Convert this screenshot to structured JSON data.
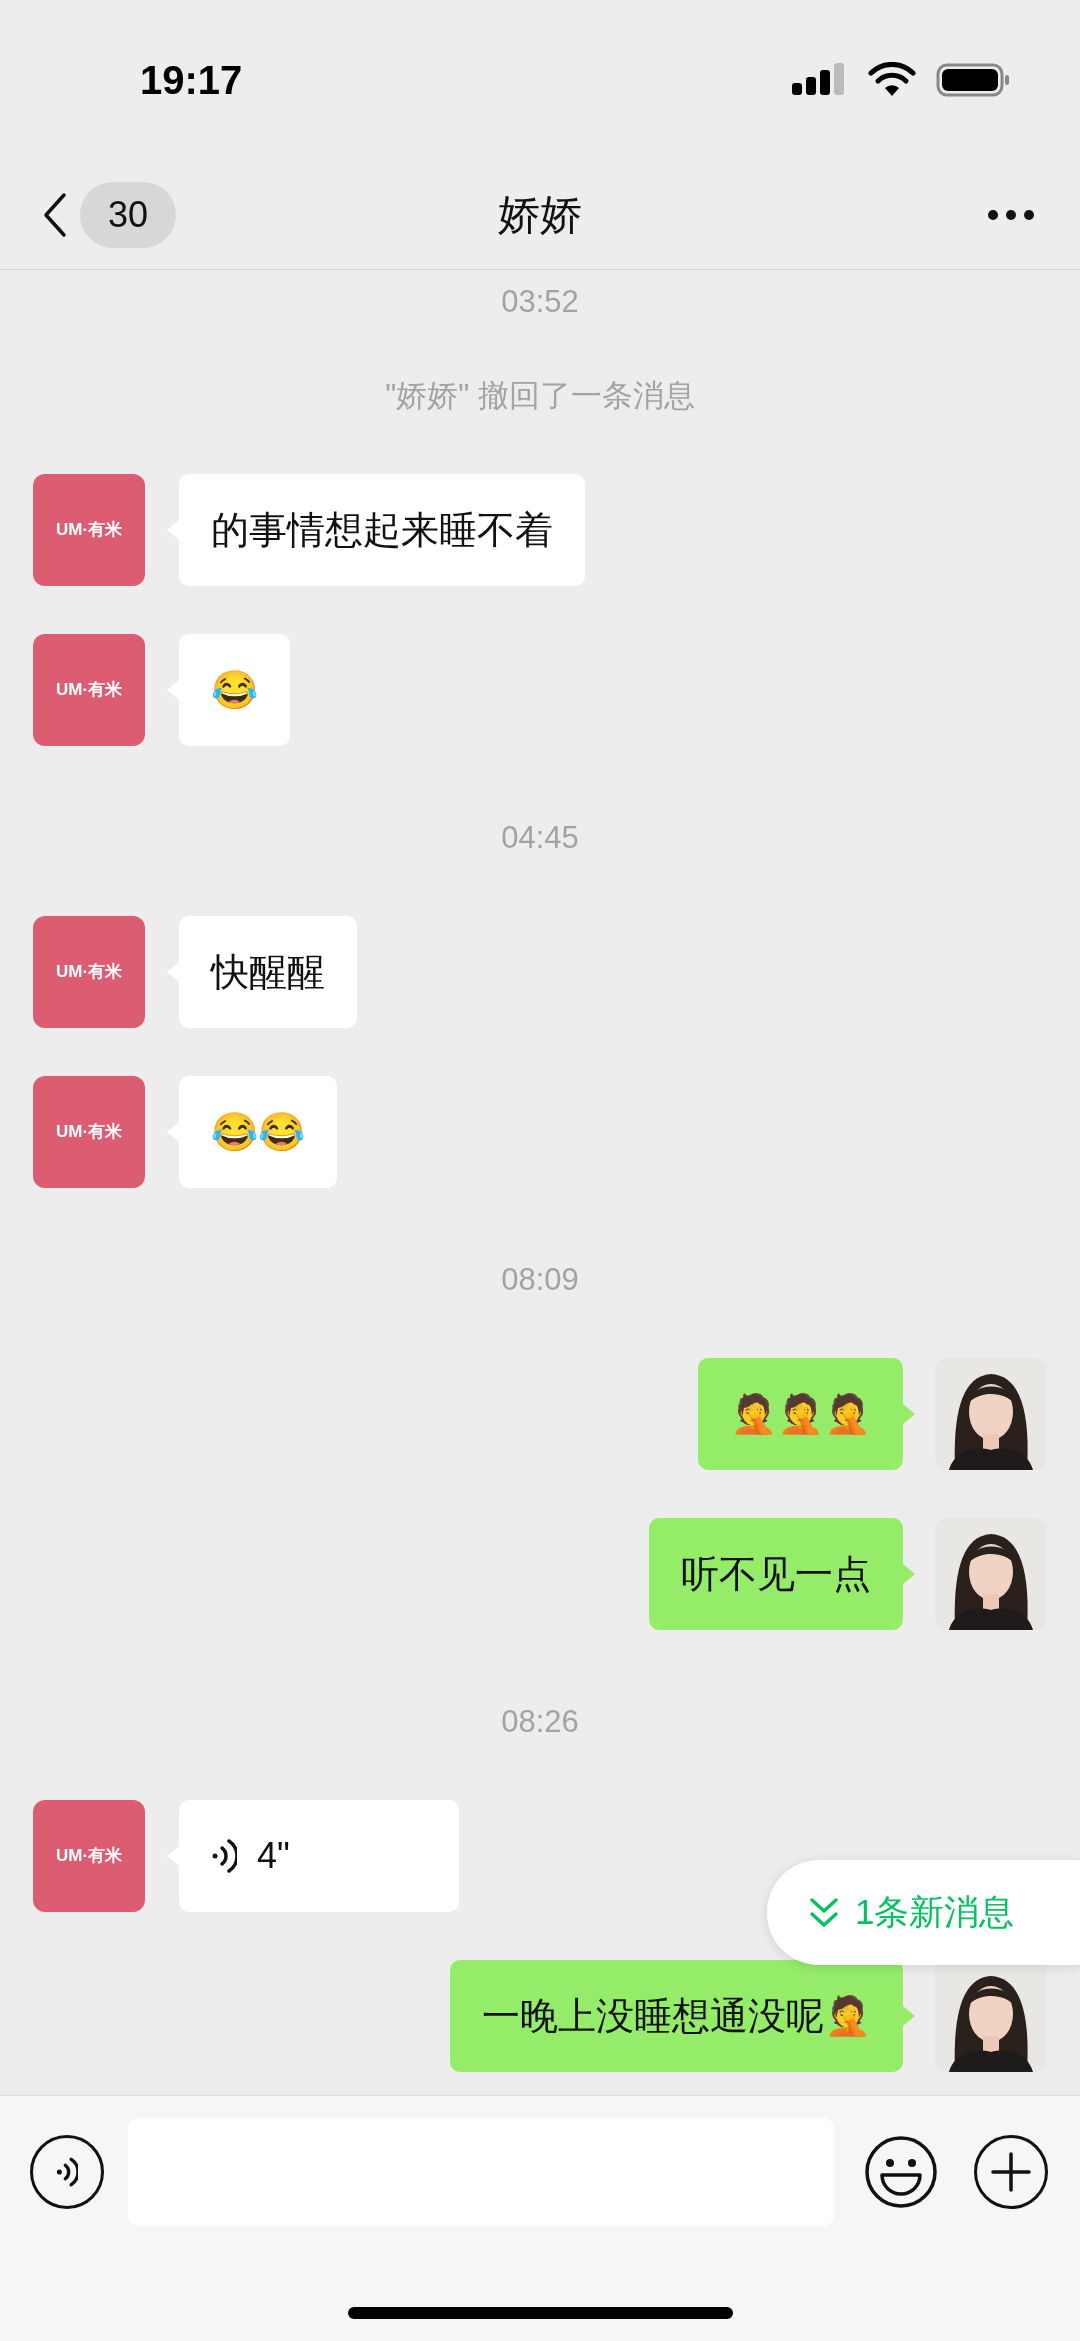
{
  "status_bar": {
    "time": "19:17"
  },
  "nav": {
    "unread": "30",
    "title": "娇娇"
  },
  "messages": [
    {
      "kind": "time",
      "text": "03:52"
    },
    {
      "kind": "notice",
      "text": "\"娇娇\" 撤回了一条消息"
    },
    {
      "kind": "text",
      "outgoing": false,
      "avatar_label": "UM·有米",
      "text": "的事情想起来睡不着"
    },
    {
      "kind": "text",
      "outgoing": false,
      "avatar_label": "UM·有米",
      "text": "😂"
    },
    {
      "kind": "time",
      "text": "04:45"
    },
    {
      "kind": "text",
      "outgoing": false,
      "avatar_label": "UM·有米",
      "text": "快醒醒"
    },
    {
      "kind": "text",
      "outgoing": false,
      "avatar_label": "UM·有米",
      "text": "😂😂"
    },
    {
      "kind": "time",
      "text": "08:09"
    },
    {
      "kind": "text",
      "outgoing": true,
      "text": "🤦🤦🤦"
    },
    {
      "kind": "text",
      "outgoing": true,
      "text": "听不见一点"
    },
    {
      "kind": "time",
      "text": "08:26"
    },
    {
      "kind": "voice",
      "outgoing": false,
      "avatar_label": "UM·有米",
      "text": "4\""
    },
    {
      "kind": "text",
      "outgoing": true,
      "text": "一晚上没睡想通没呢🤦"
    }
  ],
  "new_messages": {
    "text": "1条新消息"
  }
}
